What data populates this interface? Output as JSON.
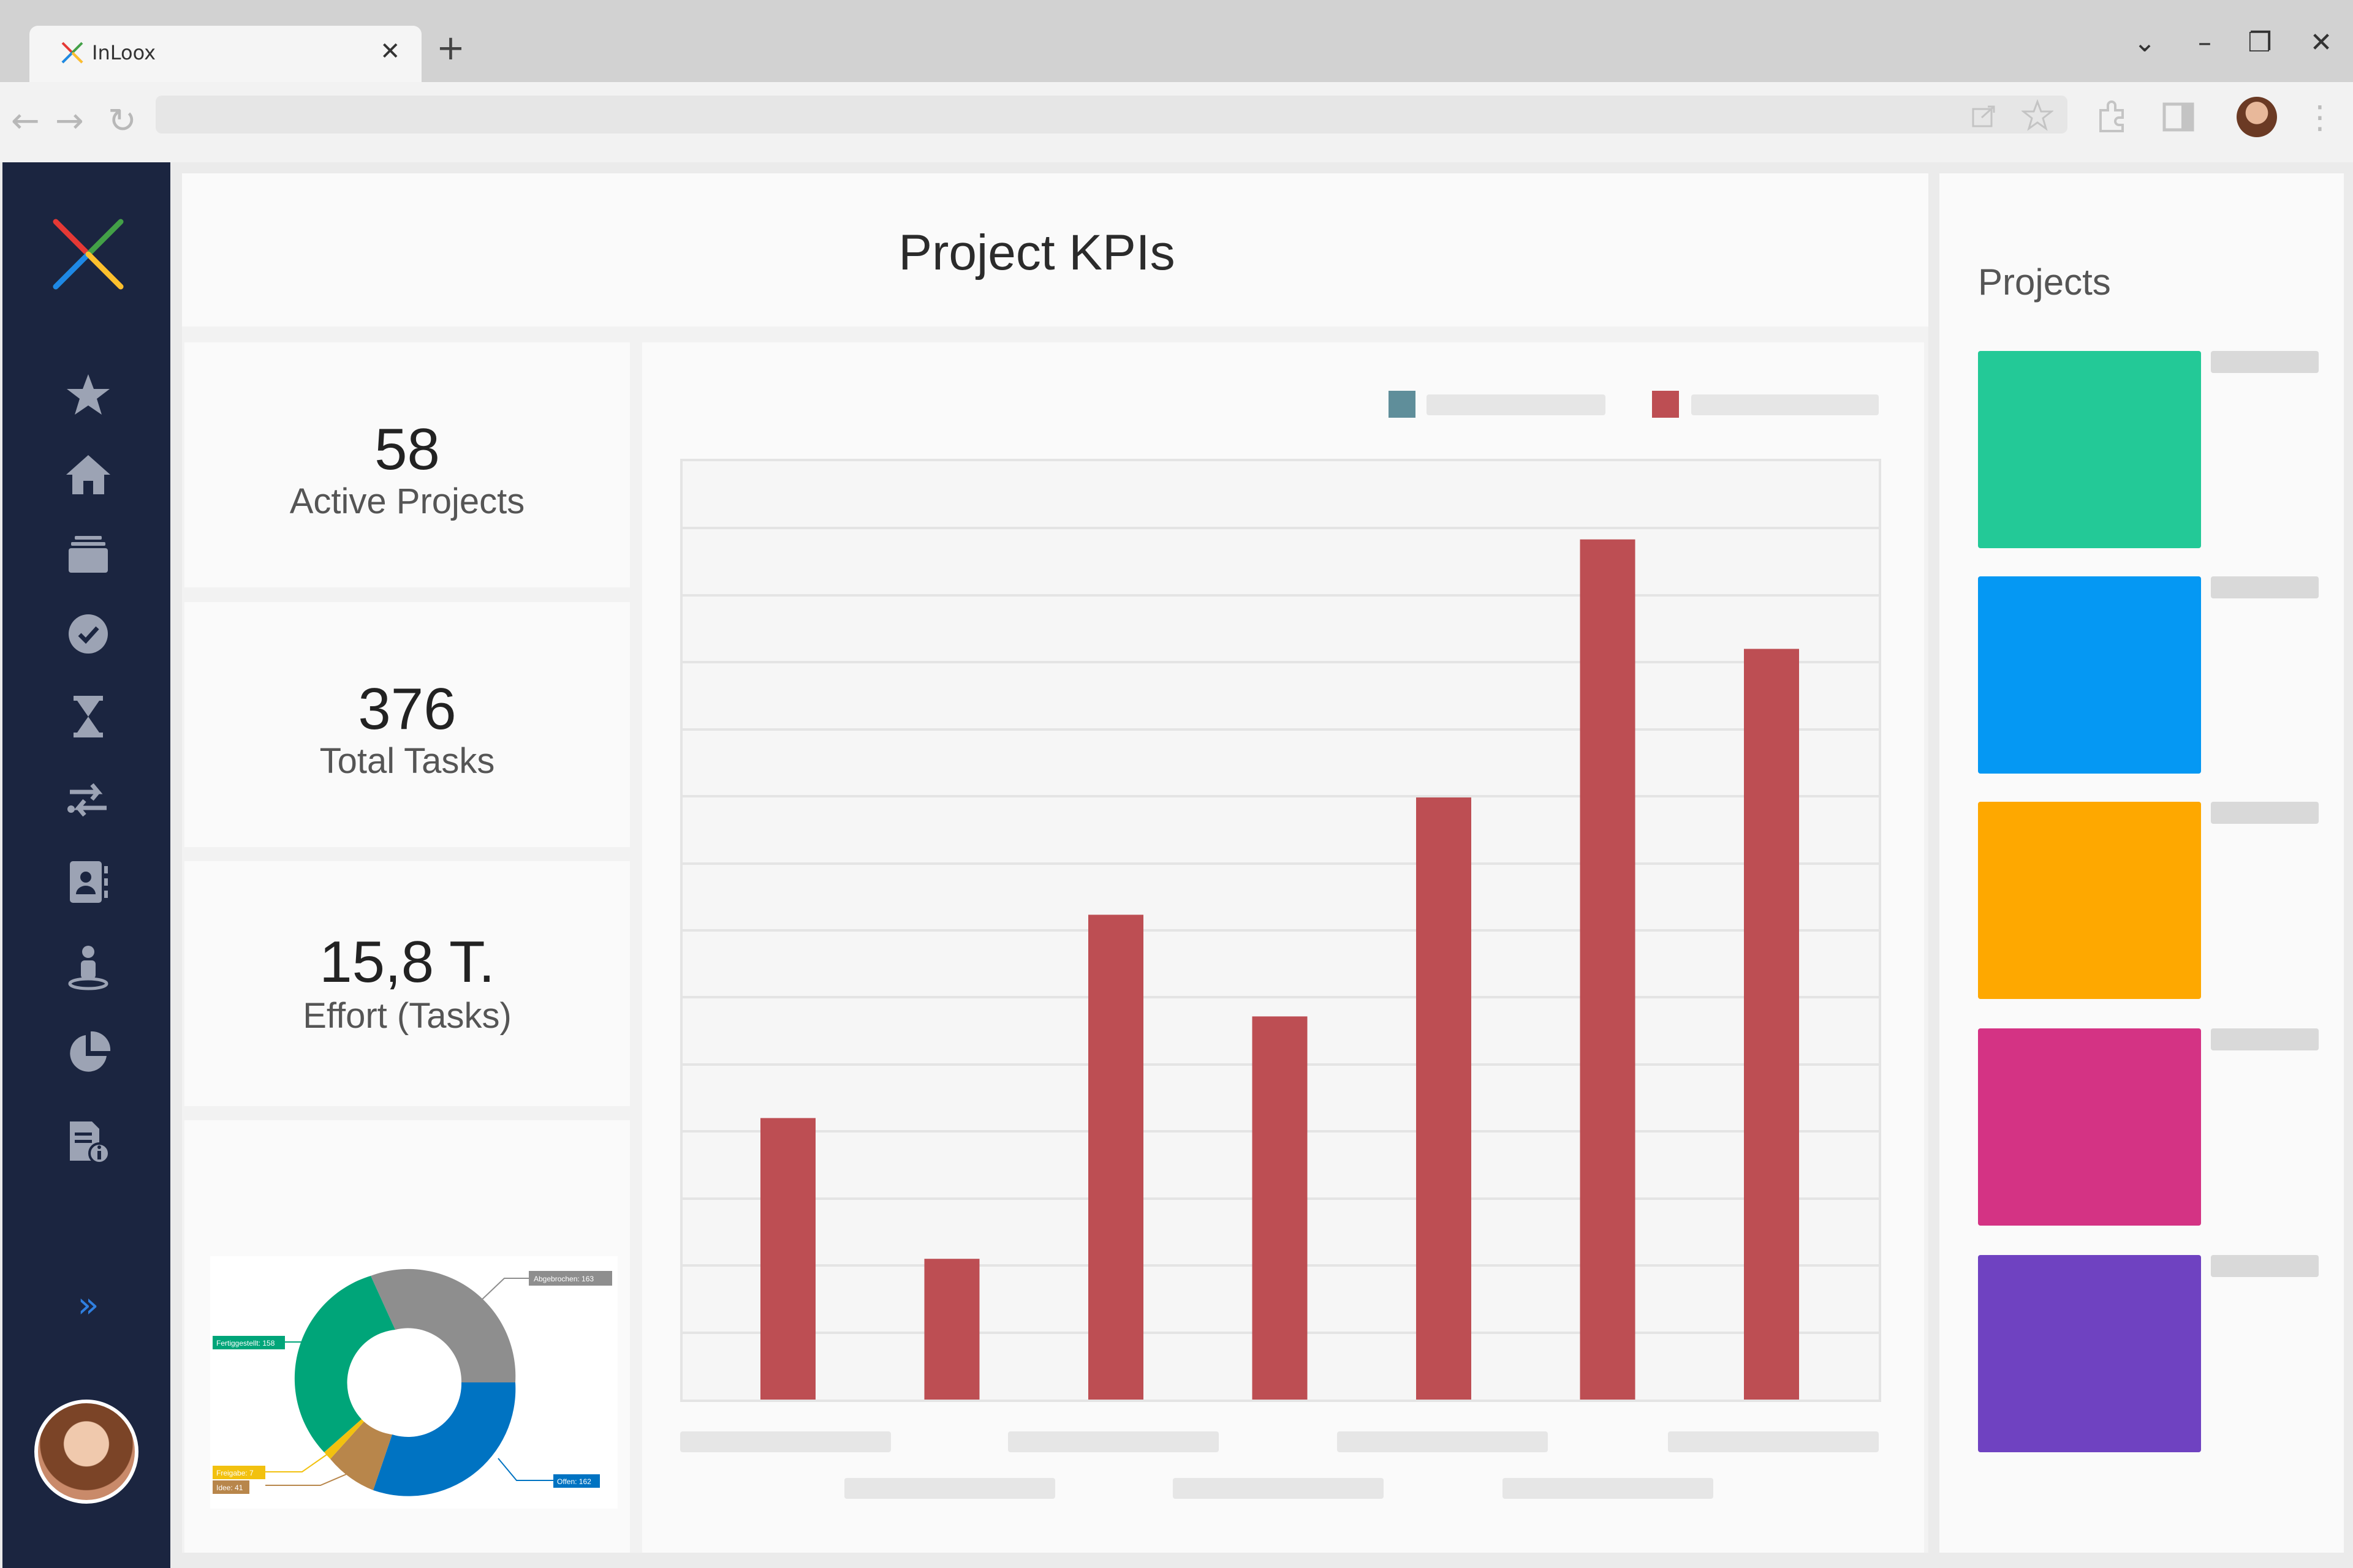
{
  "browser": {
    "tab_title": "InLoox",
    "tab_close": "✕",
    "new_tab": "+",
    "window_controls": [
      "⌄",
      "–",
      "❐",
      "✕"
    ],
    "nav": [
      "←",
      "→",
      "↻"
    ],
    "toolbar_icons": [
      "share-icon",
      "star-icon",
      "extensions-icon",
      "sidebar-icon"
    ],
    "menu": "⋮"
  },
  "sidebar": {
    "items": [
      "star-icon",
      "home-icon",
      "layers-icon",
      "check-circle-icon",
      "hourglass-icon",
      "transfer-icon",
      "contacts-icon",
      "user-icon",
      "pie-chart-icon",
      "document-info-icon"
    ],
    "expand": "»"
  },
  "header": {
    "title": "Project KPIs"
  },
  "kpis": [
    {
      "value": "58",
      "label": "Active Projects"
    },
    {
      "value": "376",
      "label": "Total Tasks"
    },
    {
      "value": "15,8 T.",
      "label": "Effort (Tasks)"
    }
  ],
  "donut": {
    "colors": [
      "#8e8e8e",
      "#0073c2",
      "#b8864b",
      "#f2c10f",
      "#00a579"
    ],
    "labels": [
      "Abgebrochen: 163",
      "Offen: 162",
      "Idee: 41",
      "Freigabe: 7",
      "Fertiggestellt: 158"
    ]
  },
  "chart_data": {
    "type": "bar",
    "categories": [
      "",
      "",
      "",
      "",
      "",
      "",
      ""
    ],
    "series": [
      {
        "values": [
          36,
          18,
          62,
          49,
          77,
          110,
          96
        ],
        "color": "#bd4e53"
      }
    ],
    "ylim": [
      0,
      120
    ],
    "grid": true,
    "legend_colors": [
      "#5f8e9a",
      "#bd4e53"
    ]
  },
  "projects": {
    "title": "Projects",
    "tiles": [
      "#23c997",
      "#0598f3",
      "#fea800",
      "#d43384",
      "#6f42c1"
    ]
  }
}
